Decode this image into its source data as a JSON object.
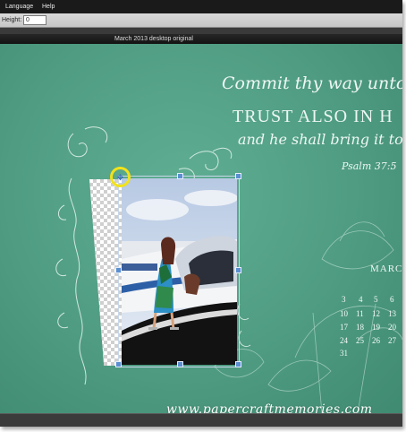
{
  "menu": {
    "items": [
      {
        "label": "Language"
      },
      {
        "label": "Help"
      }
    ]
  },
  "options": {
    "height_label": "Height:",
    "height_value": "0"
  },
  "document": {
    "title": "March 2013 desktop original"
  },
  "design": {
    "verse_line1": "Commit thy way unto the L",
    "verse_line2": "TRUST ALSO IN H",
    "verse_line3": "and he shall bring it to p",
    "reference": "Psalm 37:5",
    "month": "MARC",
    "calendar": {
      "row1": [
        "3",
        "4",
        "5",
        "6"
      ],
      "row2": [
        "10",
        "11",
        "12",
        "13"
      ],
      "row3": [
        "17",
        "18",
        "19",
        "20"
      ],
      "row4": [
        "24",
        "25",
        "26",
        "27"
      ],
      "row5": [
        "31"
      ]
    }
  },
  "watermark": "www.papercraftmemories.com",
  "colors": {
    "canvas": "#4f9c82",
    "highlight_ring": "#f2e21a",
    "handle": "#5b8fd0"
  },
  "icons": {
    "transform_cursor": "move-arrows-icon"
  }
}
